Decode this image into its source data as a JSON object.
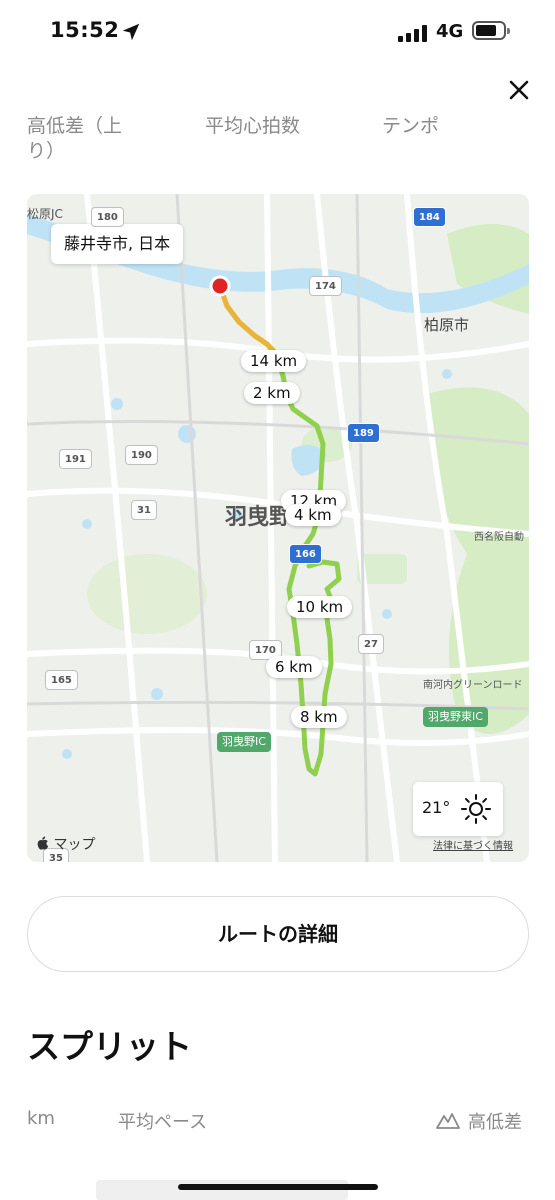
{
  "status_bar": {
    "time": "15:52",
    "network": "4G",
    "icons": [
      "location-arrow-icon",
      "signal-icon",
      "battery-icon"
    ]
  },
  "header": {
    "close_icon": "close-icon"
  },
  "metrics": {
    "labels": [
      "高低差（上り）",
      "平均心拍数",
      "テンポ"
    ]
  },
  "map": {
    "place_chip": "藤井寺市, 日本",
    "distance_labels": [
      "14 km",
      "2 km",
      "12 km",
      "4 km",
      "10 km",
      "6 km",
      "8 km"
    ],
    "city_labels": [
      "羽曳野",
      "柏原市"
    ],
    "road_labels": [
      "180",
      "184",
      "174",
      "189",
      "191",
      "190",
      "31",
      "166",
      "170",
      "27",
      "165",
      "35"
    ],
    "interchange_labels": [
      "羽曳野IC",
      "羽曳野東IC"
    ],
    "small_labels": [
      "松原JC",
      "西名阪自動",
      "南河内グリーンロード"
    ],
    "weather": {
      "temp": "21°",
      "icon": "sun-icon"
    },
    "attribution": "マップ",
    "legal_link": "法律に基づく情報",
    "colors": {
      "route": "#8fd14f",
      "route_hot": "#e8b43a",
      "start_dot": "#e02424",
      "water": "#bfe3f5",
      "park": "#d5ecc4"
    }
  },
  "route_button": {
    "label": "ルートの詳細"
  },
  "splits": {
    "title": "スプリット",
    "columns": {
      "km": "km",
      "pace": "平均ペース",
      "elevation": "高低差"
    },
    "elevation_icon": "mountain-icon"
  }
}
